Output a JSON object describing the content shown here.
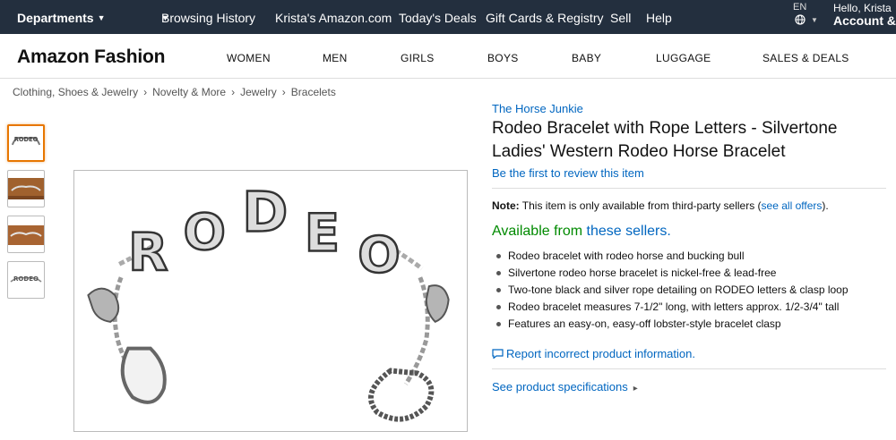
{
  "topnav": {
    "departments": "Departments",
    "links": [
      "Browsing History",
      "Krista's Amazon.com",
      "Today's Deals",
      "Gift Cards & Registry",
      "Sell",
      "Help"
    ],
    "language": "EN",
    "greeting": "Hello, Krista",
    "account": "Account &"
  },
  "subnav": {
    "brand": "Amazon Fashion",
    "categories": [
      "WOMEN",
      "MEN",
      "GIRLS",
      "BOYS",
      "BABY",
      "LUGGAGE",
      "SALES & DEALS"
    ]
  },
  "breadcrumb": [
    "Clothing, Shoes & Jewelry",
    "Novelty & More",
    "Jewelry",
    "Bracelets"
  ],
  "product": {
    "store": "The Horse Junkie",
    "title_line1": "Rodeo Bracelet with Rope Letters - Silvertone",
    "title_line2": "Ladies' Western Rodeo Horse Bracelet",
    "review_link": "Be the first to review this item",
    "note_label": "Note:",
    "note_text": "This item is only available from third-party sellers (",
    "note_link": "see all offers",
    "note_end": ").",
    "availability_text": "Available from",
    "availability_link": "these sellers.",
    "bullets": [
      "Rodeo bracelet with rodeo horse and bucking bull",
      "Silvertone rodeo horse bracelet is nickel-free & lead-free",
      "Two-tone black and silver rope detailing on RODEO letters & clasp loop",
      "Rodeo bracelet measures 7-1/2\" long, with letters approx. 1/2-3/4\" tall",
      "Features an easy-on, easy-off lobster-style bracelet clasp"
    ],
    "report_link": "Report incorrect product information.",
    "specs_link": "See product specifications",
    "image_letters": [
      "R",
      "O",
      "D",
      "E",
      "O"
    ]
  },
  "colors": {
    "nav_bg": "#232f3e",
    "link": "#0066c0",
    "available_green": "#008a00",
    "selected_thumb": "#e77600"
  }
}
